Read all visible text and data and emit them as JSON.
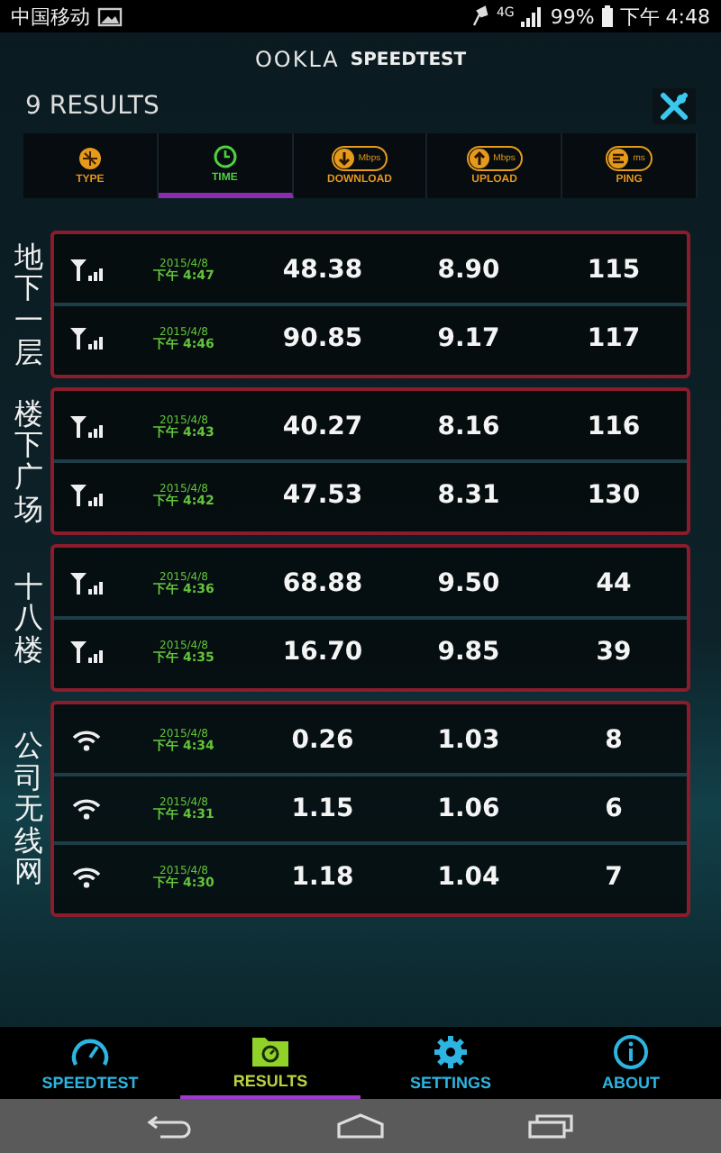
{
  "status_bar": {
    "carrier": "中国移动",
    "network": "4G",
    "battery": "99%",
    "time": "下午 4:48"
  },
  "header": {
    "logo": "OOKLA",
    "product": "SPEEDTEST"
  },
  "results_count": "9 RESULTS",
  "sort_columns": [
    {
      "label": "TYPE",
      "kind": "type",
      "selected": false
    },
    {
      "label": "TIME",
      "kind": "time",
      "selected": true
    },
    {
      "label": "DOWNLOAD",
      "kind": "download",
      "unit": "Mbps",
      "selected": false
    },
    {
      "label": "UPLOAD",
      "kind": "upload",
      "unit": "Mbps",
      "selected": false
    },
    {
      "label": "PING",
      "kind": "ping",
      "unit": "ms",
      "selected": false
    }
  ],
  "groups": [
    {
      "label": "地下一层",
      "rows": [
        {
          "kind": "cell",
          "date": "2015/4/8",
          "time": "下午 4:47",
          "download": "48.38",
          "upload": "8.90",
          "ping": "115"
        },
        {
          "kind": "cell",
          "date": "2015/4/8",
          "time": "下午 4:46",
          "download": "90.85",
          "upload": "9.17",
          "ping": "117"
        }
      ]
    },
    {
      "label": "楼下广场",
      "rows": [
        {
          "kind": "cell",
          "date": "2015/4/8",
          "time": "下午 4:43",
          "download": "40.27",
          "upload": "8.16",
          "ping": "116"
        },
        {
          "kind": "cell",
          "date": "2015/4/8",
          "time": "下午 4:42",
          "download": "47.53",
          "upload": "8.31",
          "ping": "130"
        }
      ]
    },
    {
      "label": "十八楼",
      "rows": [
        {
          "kind": "cell",
          "date": "2015/4/8",
          "time": "下午 4:36",
          "download": "68.88",
          "upload": "9.50",
          "ping": "44"
        },
        {
          "kind": "cell",
          "date": "2015/4/8",
          "time": "下午 4:35",
          "download": "16.70",
          "upload": "9.85",
          "ping": "39"
        }
      ]
    },
    {
      "label": "公司无线网",
      "rows": [
        {
          "kind": "wifi",
          "date": "2015/4/8",
          "time": "下午 4:34",
          "download": "0.26",
          "upload": "1.03",
          "ping": "8"
        },
        {
          "kind": "wifi",
          "date": "2015/4/8",
          "time": "下午 4:31",
          "download": "1.15",
          "upload": "1.06",
          "ping": "6"
        },
        {
          "kind": "wifi",
          "date": "2015/4/8",
          "time": "下午 4:30",
          "download": "1.18",
          "upload": "1.04",
          "ping": "7"
        }
      ]
    }
  ],
  "bottom_nav": [
    {
      "label": "SPEEDTEST",
      "kind": "gauge",
      "selected": false
    },
    {
      "label": "RESULTS",
      "kind": "folder",
      "selected": true
    },
    {
      "label": "SETTINGS",
      "kind": "gear",
      "selected": false
    },
    {
      "label": "ABOUT",
      "kind": "info",
      "selected": false
    }
  ]
}
